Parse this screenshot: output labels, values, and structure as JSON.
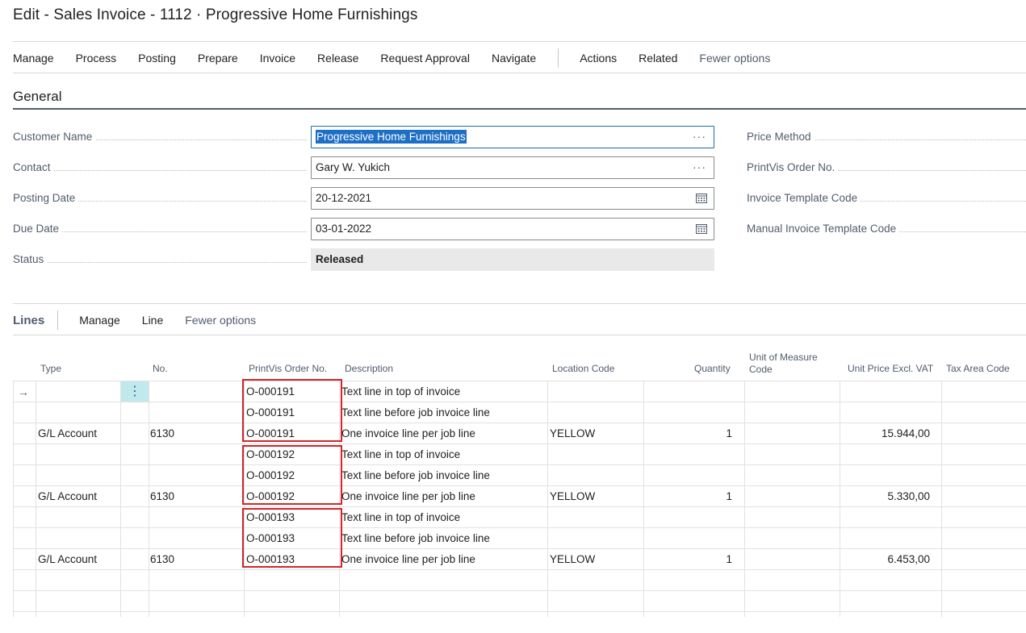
{
  "window": {
    "title": "Edit - Sales Invoice - 1112 · Progressive Home Furnishings"
  },
  "actionbar": {
    "items": [
      "Manage",
      "Process",
      "Posting",
      "Prepare",
      "Invoice",
      "Release",
      "Request Approval",
      "Navigate"
    ],
    "items2": [
      "Actions",
      "Related"
    ],
    "fewer": "Fewer options"
  },
  "general": {
    "title": "General",
    "left_fields": [
      {
        "label": "Customer Name",
        "value": "Progressive Home Furnishings"
      },
      {
        "label": "Contact",
        "value": "Gary W. Yukich"
      },
      {
        "label": "Posting Date",
        "value": "20-12-2021"
      },
      {
        "label": "Due Date",
        "value": "03-01-2022"
      },
      {
        "label": "Status",
        "value": "Released"
      }
    ],
    "right_fields": [
      {
        "label": "Price Method"
      },
      {
        "label": "PrintVis Order No."
      },
      {
        "label": "Invoice Template Code"
      },
      {
        "label": "Manual Invoice Template Code"
      }
    ],
    "ellipsis": "···"
  },
  "lines": {
    "title": "Lines",
    "actions": [
      "Manage",
      "Line"
    ],
    "fewer": "Fewer options",
    "columns": [
      "Type",
      "No.",
      "PrintVis Order No.",
      "Description",
      "Location Code",
      "Quantity",
      "Unit of Measure",
      "Code",
      "Unit Price Excl. VAT",
      "Tax Area Code"
    ],
    "row_pointer": "→",
    "kebab": "⋮",
    "rows": [
      {
        "type": "",
        "no": "",
        "order": "O-000191",
        "desc": "Text line in top of invoice",
        "loc": "",
        "qty": "",
        "price": ""
      },
      {
        "type": "",
        "no": "",
        "order": "O-000191",
        "desc": "Text line before job invoice line",
        "loc": "",
        "qty": "",
        "price": ""
      },
      {
        "type": "G/L Account",
        "no": "6130",
        "order": "O-000191",
        "desc": "One invoice line per job line",
        "loc": "YELLOW",
        "qty": "1",
        "price": "15.944,00"
      },
      {
        "type": "",
        "no": "",
        "order": "O-000192",
        "desc": "Text line in top of invoice",
        "loc": "",
        "qty": "",
        "price": ""
      },
      {
        "type": "",
        "no": "",
        "order": "O-000192",
        "desc": "Text line before job invoice line",
        "loc": "",
        "qty": "",
        "price": ""
      },
      {
        "type": "G/L Account",
        "no": "6130",
        "order": "O-000192",
        "desc": "One invoice line per job line",
        "loc": "YELLOW",
        "qty": "1",
        "price": "5.330,00"
      },
      {
        "type": "",
        "no": "",
        "order": "O-000193",
        "desc": "Text line in top of invoice",
        "loc": "",
        "qty": "",
        "price": ""
      },
      {
        "type": "",
        "no": "",
        "order": "O-000193",
        "desc": "Text line before job invoice line",
        "loc": "",
        "qty": "",
        "price": ""
      },
      {
        "type": "G/L Account",
        "no": "6130",
        "order": "O-000193",
        "desc": "One invoice line per job line",
        "loc": "YELLOW",
        "qty": "1",
        "price": "6.453,00"
      },
      {
        "type": "",
        "no": "",
        "order": "",
        "desc": "",
        "loc": "",
        "qty": "",
        "price": ""
      },
      {
        "type": "",
        "no": "",
        "order": "",
        "desc": "",
        "loc": "",
        "qty": "",
        "price": ""
      }
    ]
  },
  "colors": {
    "accent": "#1d6fc6",
    "highlight_box": "#d0262b",
    "selected_cell": "#bfe9ec"
  }
}
